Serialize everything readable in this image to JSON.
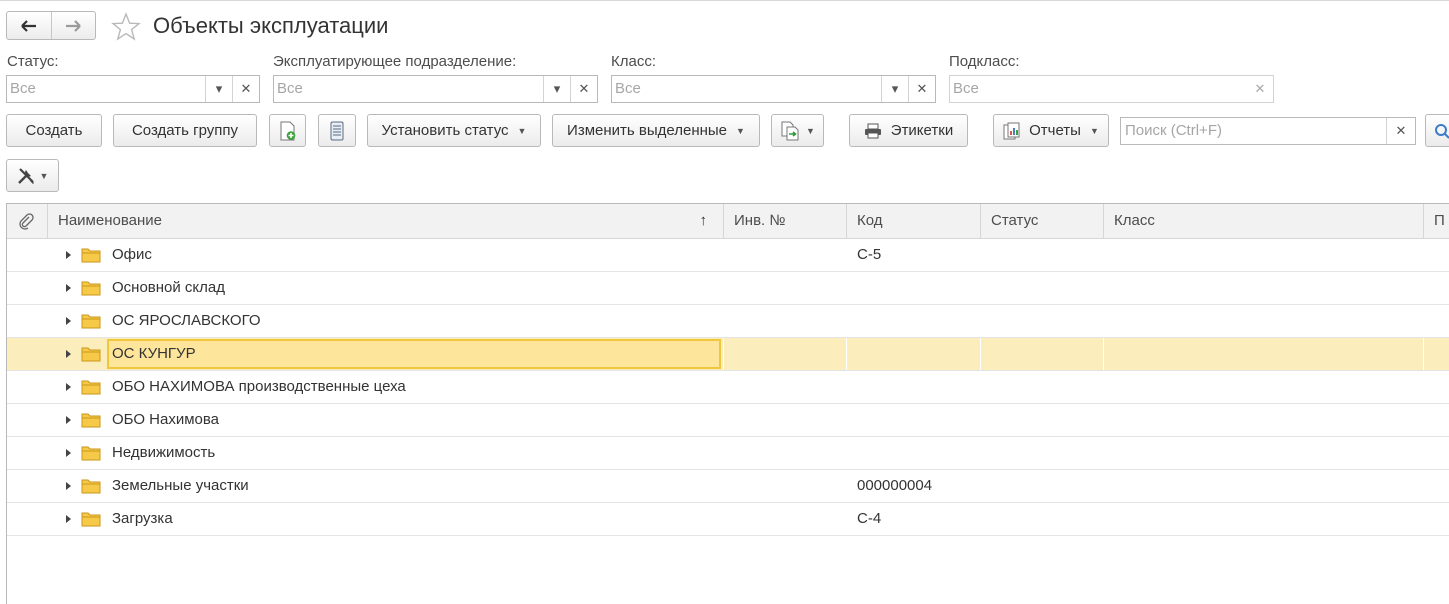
{
  "window": {
    "title": "Объекты эксплуатации"
  },
  "filters": {
    "status": {
      "label": "Статус:",
      "value": "Все"
    },
    "department": {
      "label": "Эксплуатирующее подразделение:",
      "value": "Все"
    },
    "class": {
      "label": "Класс:",
      "value": "Все"
    },
    "subclass": {
      "label": "Подкласс:",
      "value": "Все"
    }
  },
  "toolbar": {
    "create": "Создать",
    "create_group": "Создать группу",
    "set_status": "Установить статус",
    "change_selected": "Изменить выделенные",
    "labels": "Этикетки",
    "reports": "Отчеты",
    "search_placeholder": "Поиск (Ctrl+F)"
  },
  "table": {
    "columns": {
      "name": "Наименование",
      "inv": "Инв. №",
      "code": "Код",
      "status": "Статус",
      "class": "Класс",
      "subclass": "П"
    },
    "sort_indicator": "↑",
    "rows": [
      {
        "name": "Офис",
        "inv": "",
        "code": "С-5",
        "status": "",
        "class": ""
      },
      {
        "name": "Основной склад",
        "inv": "",
        "code": "",
        "status": "",
        "class": ""
      },
      {
        "name": "ОС ЯРОСЛАВСКОГО",
        "inv": "",
        "code": "",
        "status": "",
        "class": ""
      },
      {
        "name": "ОС КУНГУР",
        "inv": "",
        "code": "",
        "status": "",
        "class": ""
      },
      {
        "name": "ОБО НАХИМОВА производственные цеха",
        "inv": "",
        "code": "",
        "status": "",
        "class": ""
      },
      {
        "name": "ОБО Нахимова",
        "inv": "",
        "code": "",
        "status": "",
        "class": ""
      },
      {
        "name": "Недвижимость",
        "inv": "",
        "code": "",
        "status": "",
        "class": ""
      },
      {
        "name": "Земельные участки",
        "inv": "",
        "code": "000000004",
        "status": "",
        "class": ""
      },
      {
        "name": "Загрузка",
        "inv": "",
        "code": "С-4",
        "status": "",
        "class": ""
      }
    ],
    "selected_row": 3
  },
  "colors": {
    "selection": "#fbeebc",
    "selection_border": "#f0c63a",
    "folder": "#f7c948"
  }
}
